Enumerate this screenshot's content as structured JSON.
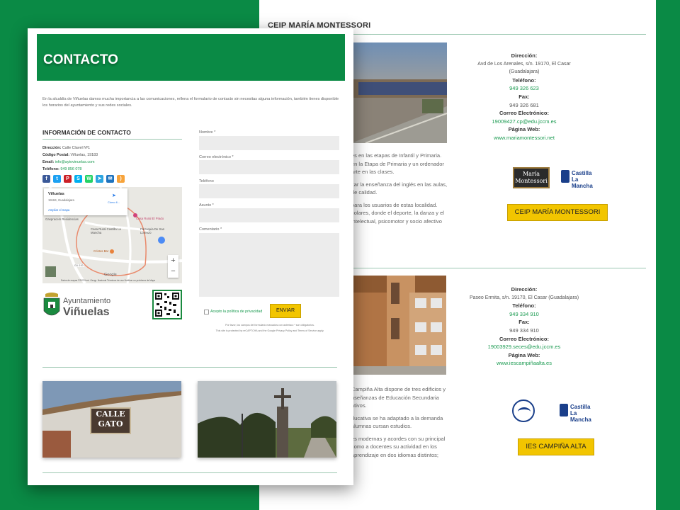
{
  "colors": {
    "brand": "#0a8a45",
    "accent_button": "#f2c500",
    "link": "#1a9a50"
  },
  "background": {
    "school1": {
      "title": "CEIP MARÍA MONTESSORI",
      "labels": {
        "address": "Dirección:",
        "phone": "Teléfono:",
        "fax": "Fax:",
        "email": "Correo Electrónico:",
        "web": "Página Web:"
      },
      "address": "Avd de Los Arenales, s/n. 19170, El Casar (Guadalajara)",
      "phone": "949 326 623",
      "fax": "949 326 681",
      "email": "19009427.cp@edu.jccm.es",
      "web": "www.mariamontessori.net",
      "desc_lines": [
        "es en las etapas de Infantil y Primaria.",
        "en la Etapa de Primaria y un ordenador",
        "arte en las clases.",
        "",
        "zar la enseñanza del inglés en las aulas,",
        "de calidad.",
        "",
        "para los usuarios de estas localidad.",
        "colares, donde el deporte, la danza y el",
        "intelectual, psicomotor y socio afectivo"
      ],
      "logo_text": "María Montessori",
      "cm_logo": "Castilla La Mancha",
      "button": "CEIP MARÍA MONTESSORI"
    },
    "school2": {
      "labels": {
        "address": "Dirección:",
        "phone": "Teléfono:",
        "fax": "Fax:",
        "email": "Correo Electrónico:",
        "web": "Página Web:"
      },
      "address": "Paseo Ermita, s/n. 19170, El Casar (Guadalajara)",
      "phone": "949 334 910",
      "fax": "949 334 910",
      "email": "19003929.seces@edu.jccm.es",
      "web": "www.iescampiñaalta.es",
      "desc_lines": [
        "Campiña Alta dispone de tres edificios y",
        "nseñanzas de Educación Secundaria",
        "ativos.",
        "",
        "ducativa se ha adaptado a la demanda",
        "alumnas cursan estudios.",
        "",
        "es modernas y acordes con su principal",
        "como a docentes su actividad en los",
        "aprendizaje en dos idiomas distintos;"
      ],
      "cm_logo": "Castilla La Mancha",
      "button": "IES CAMPIÑA ALTA"
    }
  },
  "contact": {
    "title": "CONTACTO",
    "intro": "En la alcaldía de Viñuelas damos mucha importancia a las comunicaciones, rellena el formulario de contacto sin necesitas alguna información, también tienes disponible los horarios del ayuntamiento y sus redes sociales.",
    "info_title": "INFORMACIÓN DE CONTACTO",
    "address_label": "Dirección:",
    "address": "Calle Clavel Nº1",
    "postal_label": "Código Postal:",
    "postal": "Viñuelas, 19183",
    "email_label": "Email:",
    "email": "info@aytovinuelas.com",
    "phone_label": "Teléfono:",
    "phone": "949 856 078",
    "social_icons": [
      "facebook-icon",
      "twitter-icon",
      "pinterest-icon",
      "skype-icon",
      "whatsapp-icon",
      "telegram-icon",
      "email-icon",
      "rss-icon"
    ],
    "map": {
      "place": "Viñuelas",
      "place_sub": "19184, Guadalajara",
      "directions": "Cómo ll...",
      "enlarge": "Ampliar el mapa",
      "poi1": "Gaspracem Residencias",
      "poi2": "Casa Rural El Prado",
      "poi3": "Casa Rural Castilla La Mancha",
      "poi4": "Parroquia De San Lorenzo",
      "poi5": "Cristos Bar",
      "road": "GU-193",
      "attribution": "Datos de mapas ©2023 Inst. Geogr. Nacional  Términos de uso  Notificar un problema de Maps",
      "google": "Google",
      "zoom_in": "+",
      "zoom_out": "−"
    },
    "logo": {
      "line1": "Ayuntamiento",
      "line2": "Viñuelas"
    },
    "form": {
      "name_label": "Nombre *",
      "email_label": "Correo electrónico *",
      "phone_label": "Teléfono",
      "subject_label": "Asunto *",
      "comment_label": "Comentario *",
      "privacy": "Acepto la política de privacidad",
      "submit": "ENVIAR",
      "note": "Por favor, los campos del formulario marcados con asterisco * son obligatorios.",
      "recaptcha": "This site is protected by reCAPTCHA and the Google Privacy Policy and Terms of Service apply."
    },
    "photo1_sign": [
      "CALLE",
      "GATO"
    ]
  }
}
